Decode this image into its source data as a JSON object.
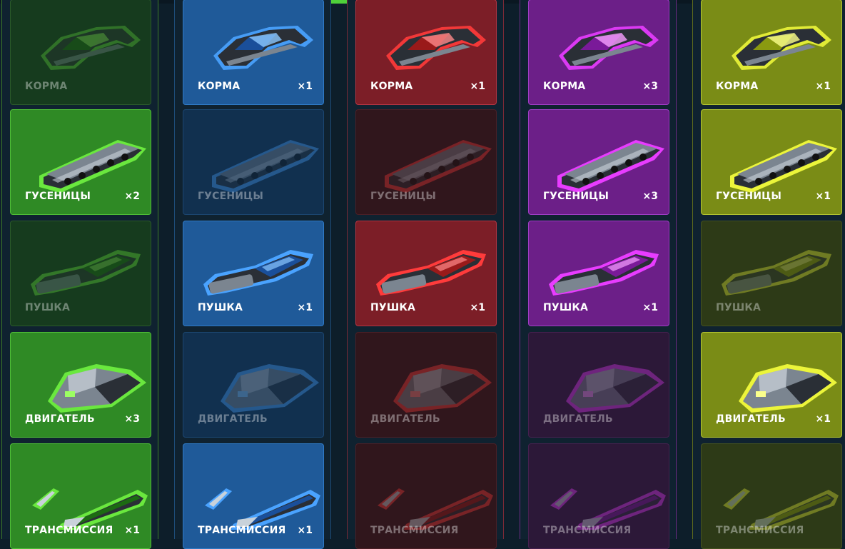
{
  "colors": {
    "background": "#0d1e2a",
    "green": "#2e8a22",
    "blue": "#1d4f8a",
    "red": "#7a1f2a",
    "purple": "#6a1e86",
    "yellow": "#7a8a14"
  },
  "columns": [
    {
      "key": "green",
      "cards": [
        {
          "label": "КОРМА",
          "count": "",
          "active": false,
          "icon": "hull-icon"
        },
        {
          "label": "ГУСЕНИЦЫ",
          "count": "×2",
          "active": true,
          "icon": "tracks-icon"
        },
        {
          "label": "ПУШКА",
          "count": "",
          "active": false,
          "icon": "cannon-icon"
        },
        {
          "label": "ДВИГАТЕЛЬ",
          "count": "×3",
          "active": true,
          "icon": "engine-icon"
        },
        {
          "label": "ТРАНСМИССИЯ",
          "count": "×1",
          "active": true,
          "icon": "transmission-icon"
        }
      ]
    },
    {
      "key": "blue",
      "cards": [
        {
          "label": "КОРМА",
          "count": "×1",
          "active": true,
          "icon": "hull-icon"
        },
        {
          "label": "ГУСЕНИЦЫ",
          "count": "",
          "active": false,
          "icon": "tracks-icon"
        },
        {
          "label": "ПУШКА",
          "count": "×1",
          "active": true,
          "icon": "cannon-icon"
        },
        {
          "label": "ДВИГАТЕЛЬ",
          "count": "",
          "active": false,
          "icon": "engine-icon"
        },
        {
          "label": "ТРАНСМИССИЯ",
          "count": "×1",
          "active": true,
          "icon": "transmission-icon"
        }
      ]
    },
    {
      "key": "red",
      "cards": [
        {
          "label": "КОРМА",
          "count": "×1",
          "active": true,
          "icon": "hull-icon"
        },
        {
          "label": "ГУСЕНИЦЫ",
          "count": "",
          "active": false,
          "icon": "tracks-icon"
        },
        {
          "label": "ПУШКА",
          "count": "×1",
          "active": true,
          "icon": "cannon-icon"
        },
        {
          "label": "ДВИГАТЕЛЬ",
          "count": "",
          "active": false,
          "icon": "engine-icon"
        },
        {
          "label": "ТРАНСМИССИЯ",
          "count": "",
          "active": false,
          "icon": "transmission-icon"
        }
      ]
    },
    {
      "key": "purple",
      "cards": [
        {
          "label": "КОРМА",
          "count": "×3",
          "active": true,
          "icon": "hull-icon"
        },
        {
          "label": "ГУСЕНИЦЫ",
          "count": "×3",
          "active": true,
          "icon": "tracks-icon"
        },
        {
          "label": "ПУШКА",
          "count": "×1",
          "active": true,
          "icon": "cannon-icon"
        },
        {
          "label": "ДВИГАТЕЛЬ",
          "count": "",
          "active": false,
          "icon": "engine-icon"
        },
        {
          "label": "ТРАНСМИССИЯ",
          "count": "",
          "active": false,
          "icon": "transmission-icon"
        }
      ]
    },
    {
      "key": "yellow",
      "cards": [
        {
          "label": "КОРМА",
          "count": "×1",
          "active": true,
          "icon": "hull-icon"
        },
        {
          "label": "ГУСЕНИЦЫ",
          "count": "×1",
          "active": true,
          "icon": "tracks-icon"
        },
        {
          "label": "ПУШКА",
          "count": "",
          "active": false,
          "icon": "cannon-icon"
        },
        {
          "label": "ДВИГАТЕЛЬ",
          "count": "×1",
          "active": true,
          "icon": "engine-icon"
        },
        {
          "label": "ТРАНСМИССИЯ",
          "count": "",
          "active": false,
          "icon": "transmission-icon"
        }
      ]
    }
  ]
}
